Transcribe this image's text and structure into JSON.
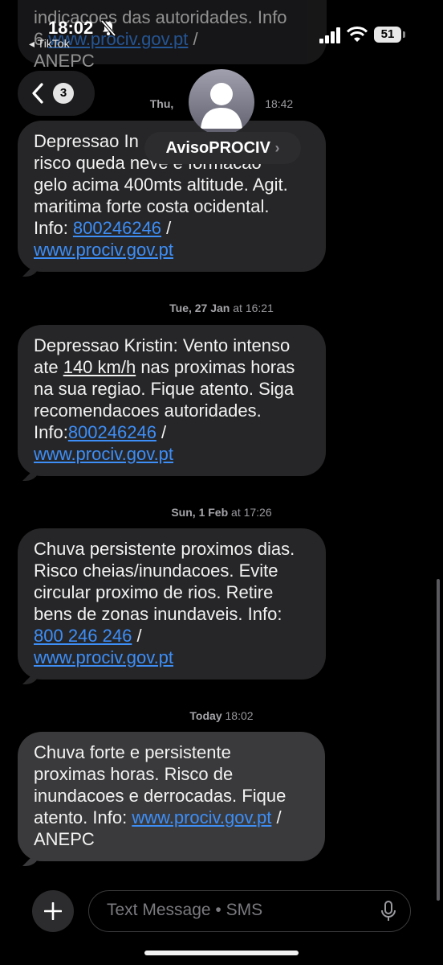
{
  "status_bar": {
    "time": "18:02",
    "back_app": "◂ TikTok",
    "battery": "51"
  },
  "header": {
    "back_count": "3",
    "contact_name": "AvisoPROCIV",
    "chevron": "›"
  },
  "partial_top_message": {
    "line1": "indicacoes das autoridades. Info",
    "line2_tail": "6",
    "line2_link": "www.prociv.gov.pt",
    "line2_sep": " /",
    "line3": "ANEPC"
  },
  "timestamps": [
    {
      "day": "Thu,",
      "time": "18:42"
    },
    {
      "day": "Tue, 27 Jan",
      "time": "at 16:21"
    },
    {
      "day": "Sun, 1 Feb",
      "time": "at 17:26"
    },
    {
      "day": "Today",
      "time": "18:02"
    }
  ],
  "messages": [
    {
      "line1": "Depressao In",
      "line2": "risco queda neve e formacao",
      "line3": "gelo acima 400mts altitude. Agit.",
      "line4": "maritima forte costa ocidental.",
      "info_label": "Info: ",
      "phone": "800246246",
      "sep": " /",
      "link": "www.prociv.gov.pt"
    },
    {
      "line1": "Depressao Kristin: Vento intenso",
      "line2_pre": "ate ",
      "speed": "140 km/h",
      "line2_post": " nas proximas horas",
      "line3": "na sua regiao. Fique atento. Siga",
      "line4": "recomendacoes autoridades.",
      "info_label": "Info:",
      "phone": "800246246",
      "sep": " /",
      "link": "www.prociv.gov.pt"
    },
    {
      "line1": "Chuva persistente proximos dias.",
      "line2": "Risco cheias/inundacoes. Evite",
      "line3": "circular proximo de rios. Retire",
      "line4": "bens de zonas inundaveis. Info:",
      "phone": "800 246 246",
      "sep": " /",
      "link": "www.prociv.gov.pt"
    },
    {
      "line1": "Chuva forte e persistente",
      "line2": "proximas horas. Risco de",
      "line3": "inundacoes e derrocadas. Fique",
      "line4_pre": "atento. Info: ",
      "link": "www.prociv.gov.pt",
      "sep": "  /",
      "line5": "ANEPC"
    }
  ],
  "input": {
    "placeholder": "Text Message • SMS"
  },
  "colors": {
    "bubble": "#262628",
    "last_bubble": "#3a3a3c",
    "link": "#3d8ef7",
    "background": "#000000"
  },
  "icons": [
    "back-chevron-icon",
    "contact-silhouette-icon",
    "plus-icon",
    "microphone-icon",
    "signal-icon",
    "wifi-icon",
    "battery-icon",
    "mute-bell-icon"
  ]
}
